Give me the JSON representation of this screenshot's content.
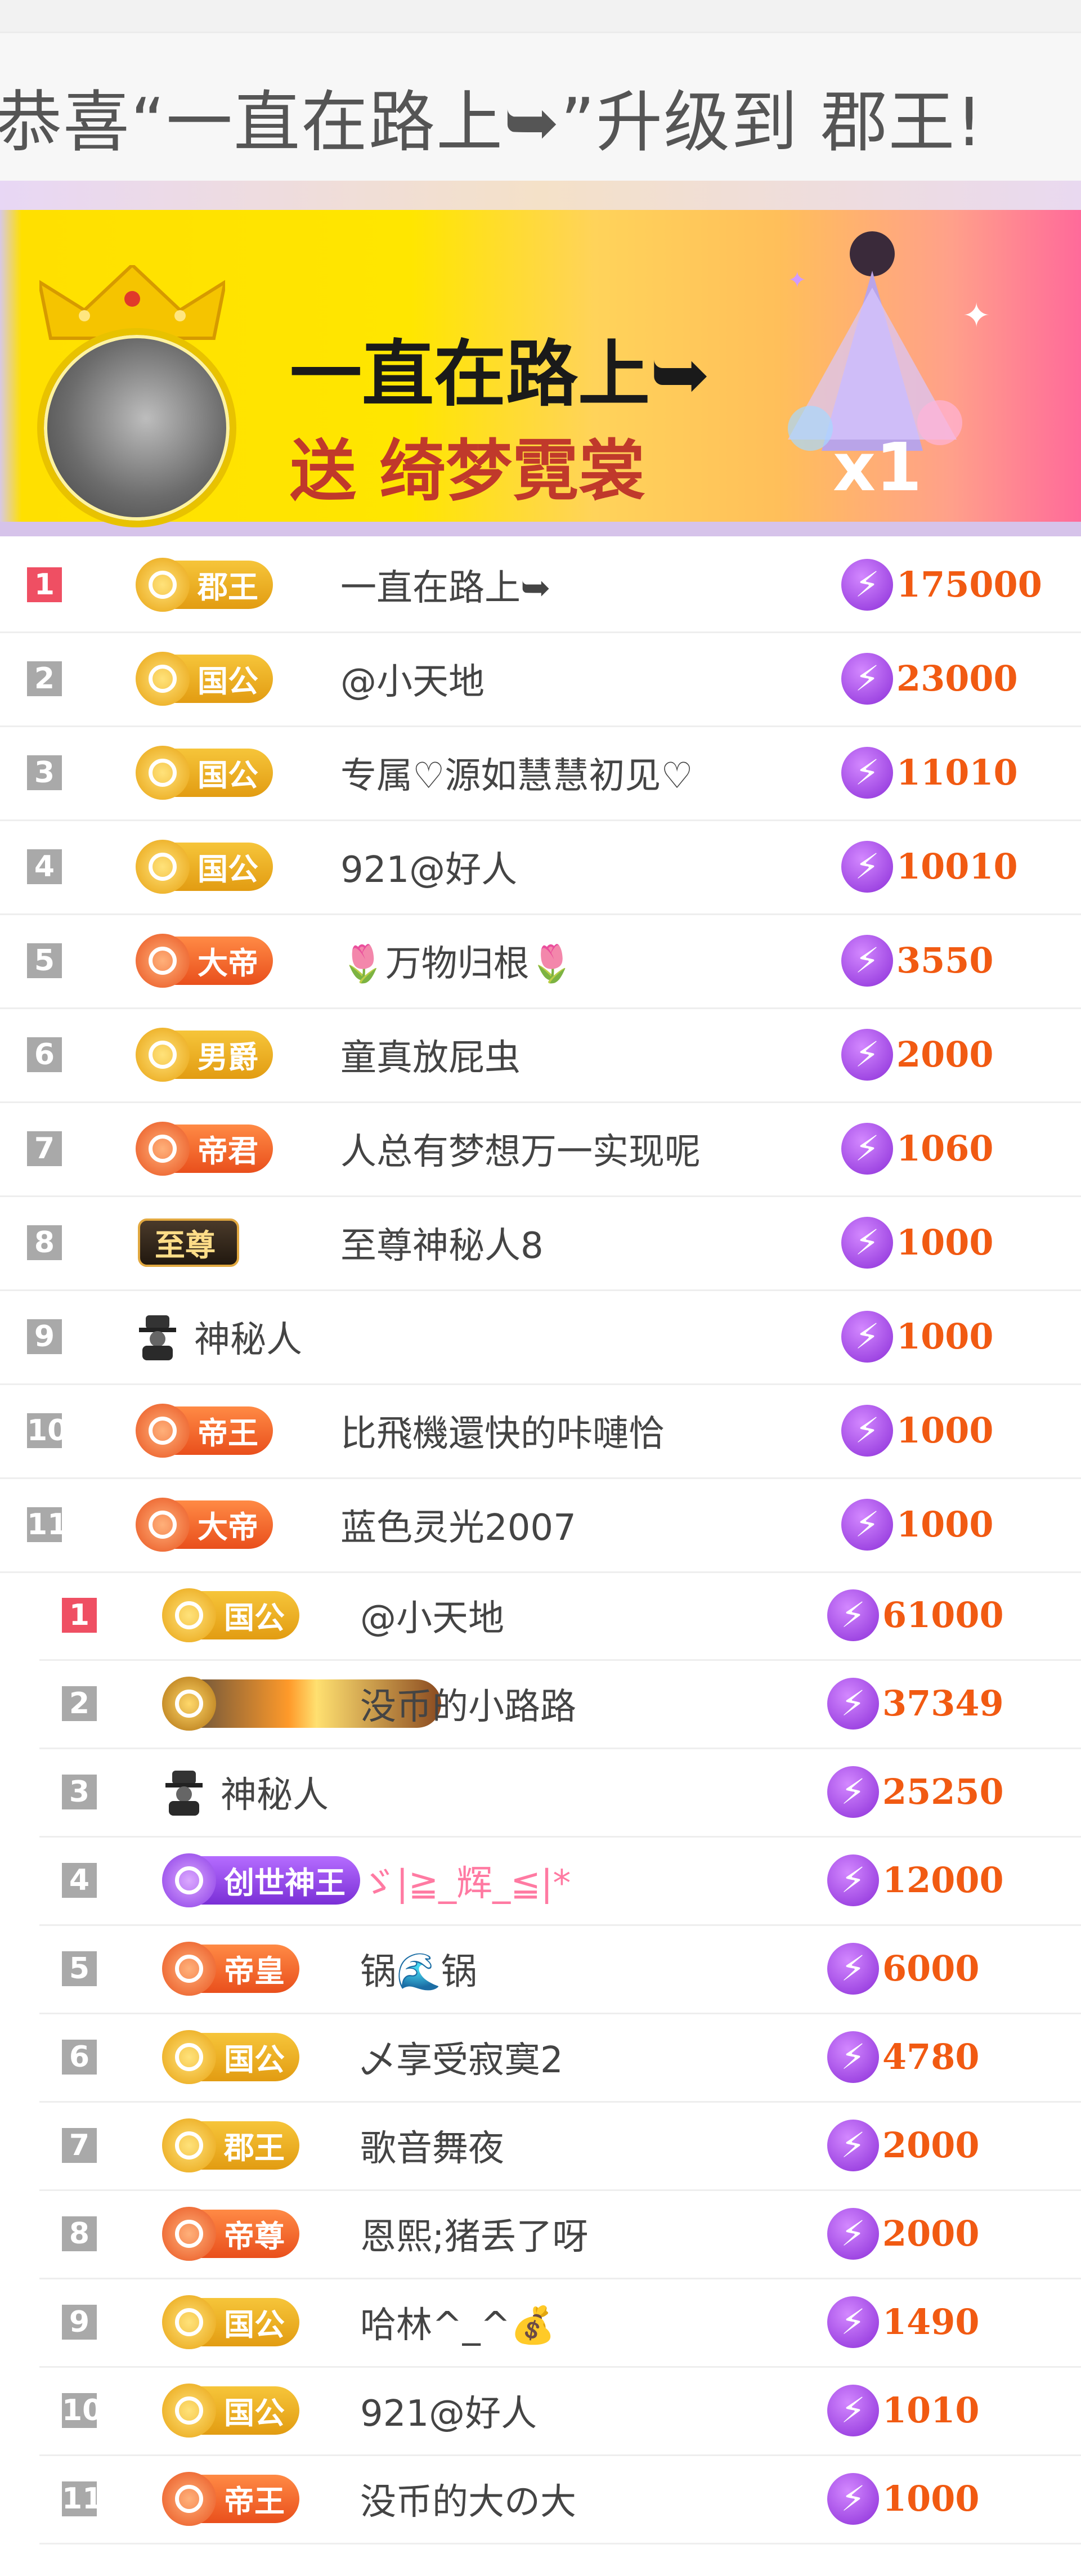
{
  "notice": {
    "text": "恭喜“一直在路上➥”升级到 郡王!"
  },
  "banner": {
    "user_name": "一直在路上➥",
    "gift_text": "送 绮梦霓裳",
    "gift_count": "x1",
    "colors": {
      "gradient_start": "#ffe000",
      "gradient_end": "#ff6a9a"
    }
  },
  "list_top": [
    {
      "rank": "1",
      "badge": "郡王",
      "badge_style": "gold",
      "name": "一直在路上➥",
      "score": "175000"
    },
    {
      "rank": "2",
      "badge": "国公",
      "badge_style": "gold",
      "name": "@小天地",
      "score": "23000"
    },
    {
      "rank": "3",
      "badge": "国公",
      "badge_style": "gold",
      "name": "专属♡源如慧慧初见♡",
      "score": "11010"
    },
    {
      "rank": "4",
      "badge": "国公",
      "badge_style": "gold",
      "name": "921@好人",
      "score": "10010"
    },
    {
      "rank": "5",
      "badge": "大帝",
      "badge_style": "orange",
      "name": "🌷万物归根🌷",
      "score": "3550"
    },
    {
      "rank": "6",
      "badge": "男爵",
      "badge_style": "gold",
      "name": "童真放屁虫",
      "score": "2000"
    },
    {
      "rank": "7",
      "badge": "帝君",
      "badge_style": "orange",
      "name": "人总有梦想万一实现呢",
      "score": "1060"
    },
    {
      "rank": "8",
      "badge": "至尊",
      "badge_style": "dark",
      "name": "至尊神秘人8",
      "score": "1000"
    },
    {
      "rank": "9",
      "badge": "",
      "badge_style": "spy",
      "name": "神秘人",
      "score": "1000"
    },
    {
      "rank": "10",
      "badge": "帝王",
      "badge_style": "orange",
      "name": "比飛機還快的咔嗹恰",
      "score": "1000"
    },
    {
      "rank": "11",
      "badge": "大帝",
      "badge_style": "orange",
      "name": "蓝色灵光2007",
      "score": "1000"
    }
  ],
  "list_second": [
    {
      "rank": "1",
      "badge": "国公",
      "badge_style": "gold",
      "name": "@小天地",
      "score": "61000"
    },
    {
      "rank": "2",
      "badge": "",
      "badge_style": "fire",
      "name": "没币的小路路",
      "score": "37349"
    },
    {
      "rank": "3",
      "badge": "",
      "badge_style": "spy",
      "name": "神秘人",
      "score": "25250"
    },
    {
      "rank": "4",
      "badge": "创世神王",
      "badge_style": "purple",
      "name": "ゞ|≧_辉_≦|*",
      "score": "12000"
    },
    {
      "rank": "5",
      "badge": "帝皇",
      "badge_style": "orange",
      "name": "锅🌊锅",
      "score": "6000"
    },
    {
      "rank": "6",
      "badge": "国公",
      "badge_style": "gold",
      "name": "乄享受寂寞2",
      "score": "4780"
    },
    {
      "rank": "7",
      "badge": "郡王",
      "badge_style": "gold",
      "name": "歌音舞夜",
      "score": "2000"
    },
    {
      "rank": "8",
      "badge": "帝尊",
      "badge_style": "orange",
      "name": "恩熙;猪丢了呀",
      "score": "2000"
    },
    {
      "rank": "9",
      "badge": "国公",
      "badge_style": "gold",
      "name": "哈林^_^💰",
      "score": "1490"
    },
    {
      "rank": "10",
      "badge": "国公",
      "badge_style": "gold",
      "name": "921@好人",
      "score": "1010"
    },
    {
      "rank": "11",
      "badge": "帝王",
      "badge_style": "orange",
      "name": "没币的大の大",
      "score": "1000"
    }
  ]
}
